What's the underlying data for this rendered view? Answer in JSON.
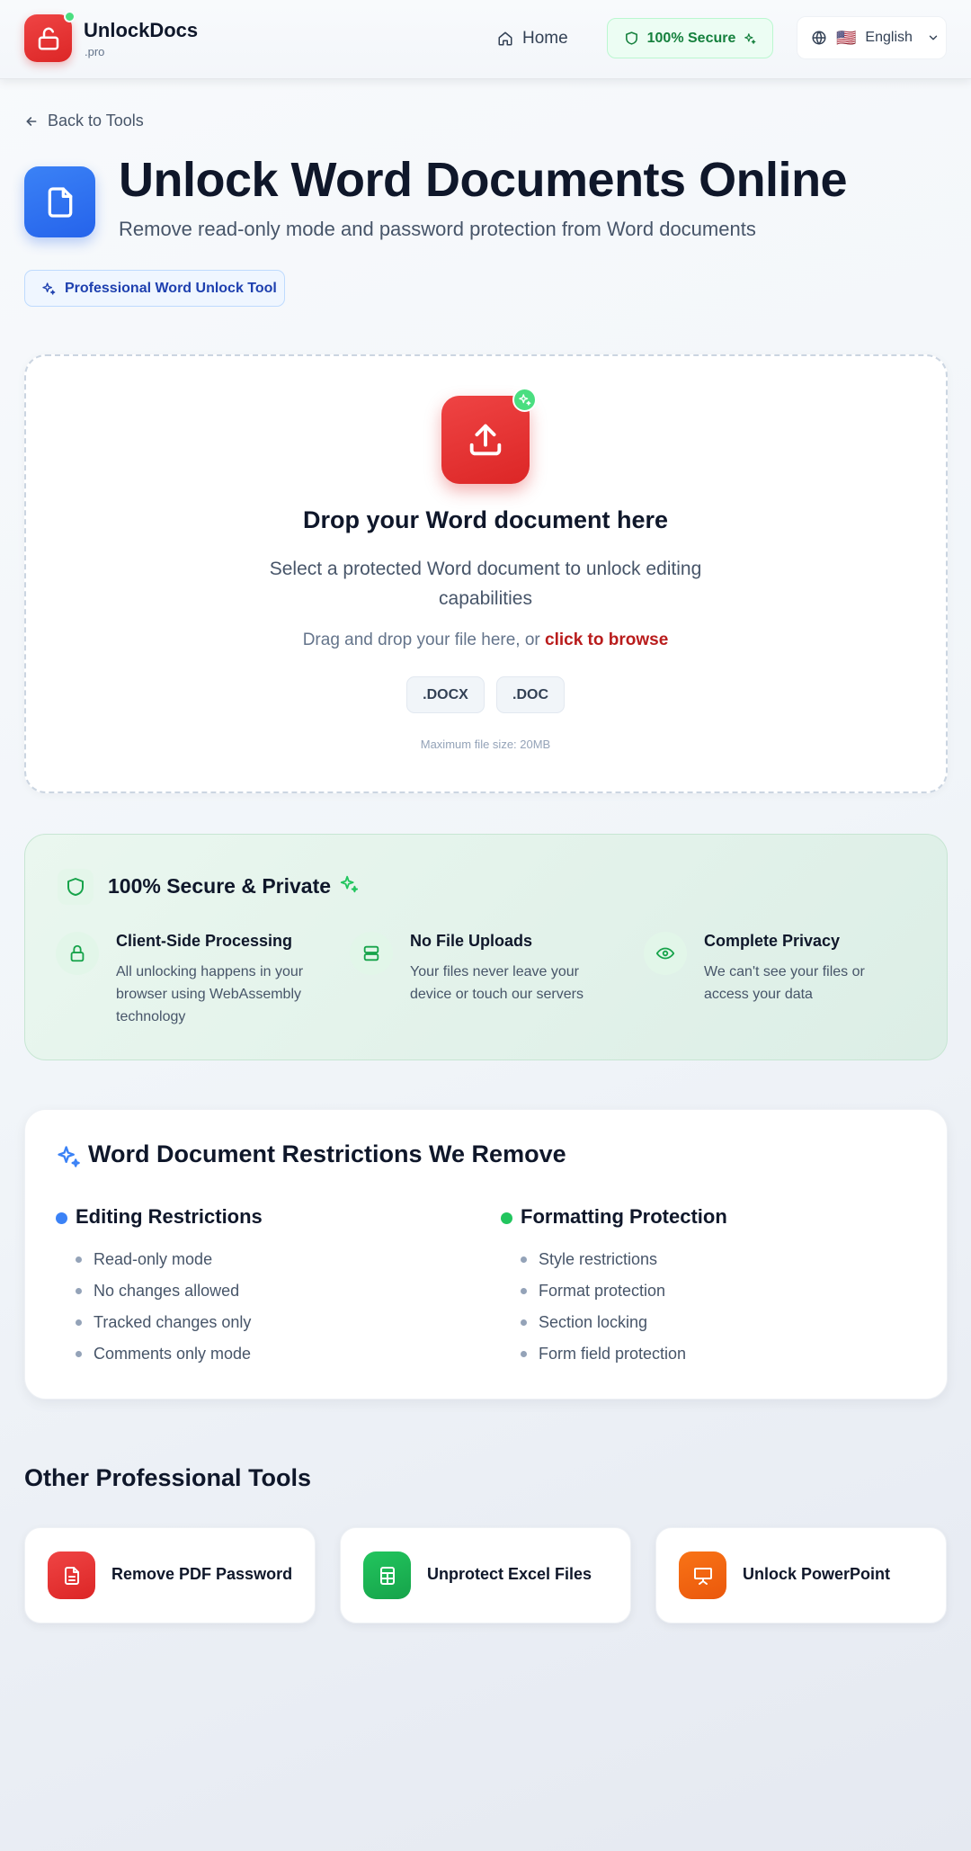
{
  "header": {
    "brand_name": "UnlockDocs",
    "brand_tld": ".pro",
    "nav_home": "Home",
    "secure_label": "100% Secure",
    "language_label": "English",
    "language_flag": "🇺🇸"
  },
  "back_link": "Back to Tools",
  "title": "Unlock Word Documents Online",
  "subtitle": "Remove read-only mode and password protection from Word documents",
  "badge": "Professional Word Unlock Tool",
  "upload": {
    "title": "Drop your Word document here",
    "description": "Select a protected Word document to unlock editing capabilities",
    "hint_prefix": "Drag and drop your file here, or ",
    "hint_link": "click to browse",
    "formats": [
      ".DOCX",
      ".DOC"
    ],
    "max_size": "Maximum file size: 20MB"
  },
  "security": {
    "title": "100% Secure & Private",
    "features": [
      {
        "icon": "lock-icon",
        "title": "Client-Side Processing",
        "desc": "All unlocking happens in your browser using WebAssembly technology"
      },
      {
        "icon": "server-icon",
        "title": "No File Uploads",
        "desc": "Your files never leave your device or touch our servers"
      },
      {
        "icon": "eye-icon",
        "title": "Complete Privacy",
        "desc": "We can't see your files or access your data"
      }
    ]
  },
  "restrictions": {
    "title": "Word Document Restrictions We Remove",
    "columns": [
      {
        "title": "Editing Restrictions",
        "color": "#3b82f6",
        "items": [
          "Read-only mode",
          "No changes allowed",
          "Tracked changes only",
          "Comments only mode"
        ]
      },
      {
        "title": "Formatting Protection",
        "color": "#22c55e",
        "items": [
          "Style restrictions",
          "Format protection",
          "Section locking",
          "Form field protection"
        ]
      }
    ]
  },
  "other_tools": {
    "title": "Other Professional Tools",
    "items": [
      {
        "label": "Remove PDF Password",
        "color": "#dc2626",
        "icon": "pdf-file-icon"
      },
      {
        "label": "Unprotect Excel Files",
        "color": "#16a34a",
        "icon": "spreadsheet-icon"
      },
      {
        "label": "Unlock PowerPoint",
        "color": "#ea580c",
        "icon": "presentation-icon"
      }
    ]
  },
  "colors": {
    "brand_red": "#dc2626",
    "word_blue": "#2563eb",
    "secure_green": "#15803d"
  }
}
